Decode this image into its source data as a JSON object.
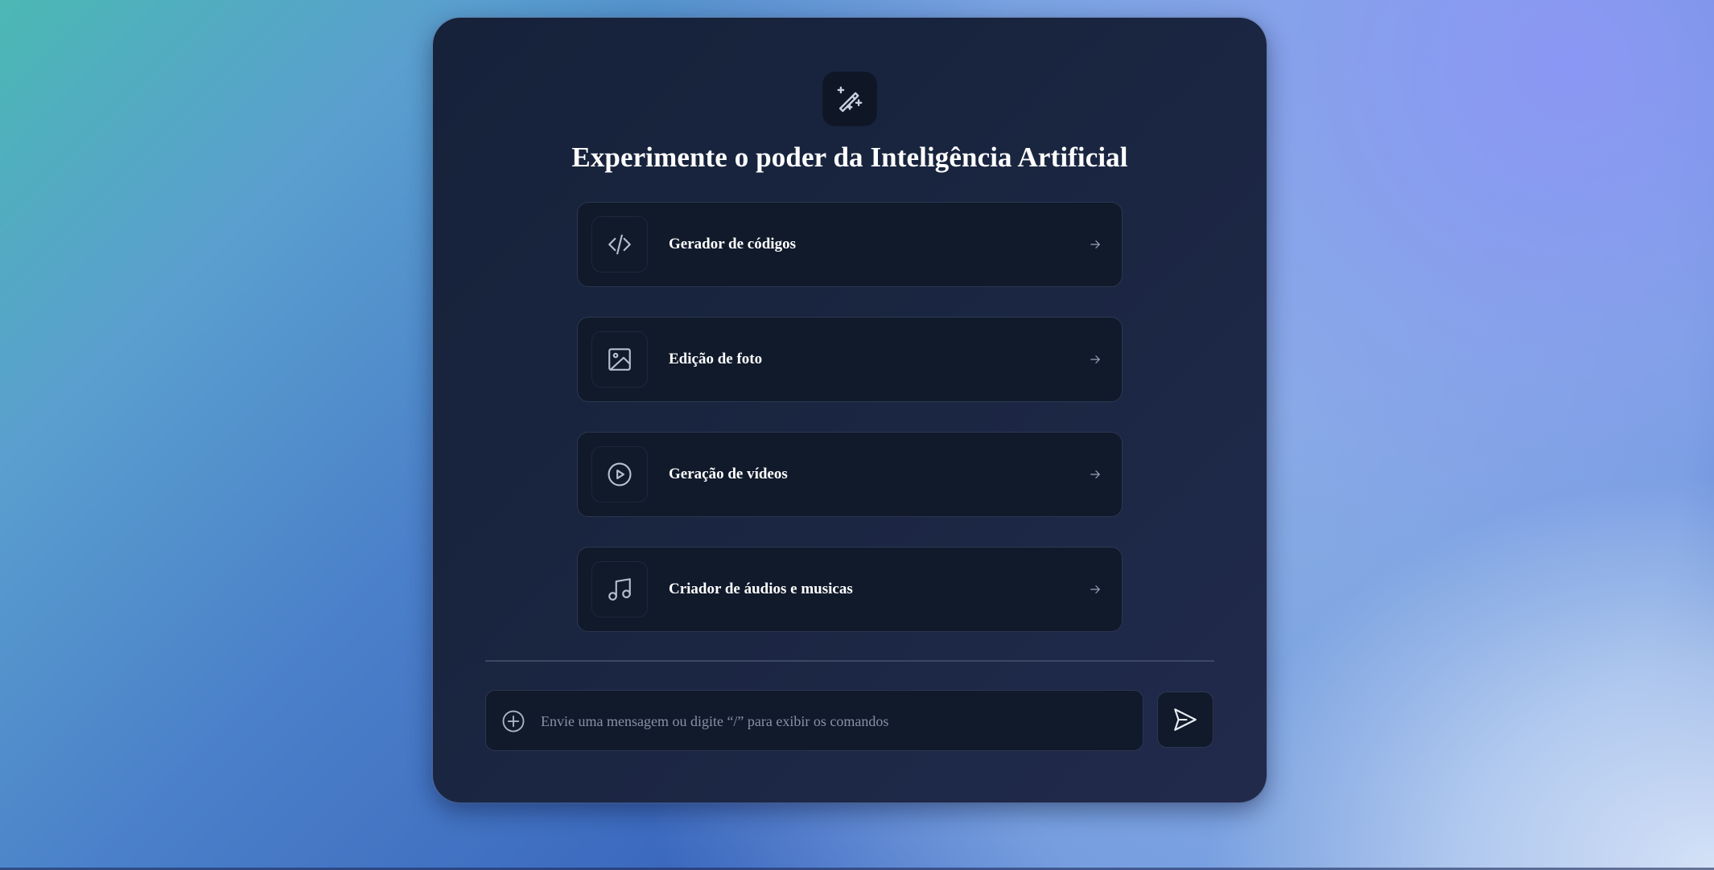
{
  "header": {
    "icon": "magic-wand-sparkles-icon",
    "title": "Experimente o poder da Inteligência Artificial"
  },
  "options": [
    {
      "label": "Gerador de códigos",
      "icon": "code-icon"
    },
    {
      "label": "Edição de foto",
      "icon": "image-icon"
    },
    {
      "label": "Geração de vídeos",
      "icon": "play-circle-icon"
    },
    {
      "label": "Criador de áudios e musicas",
      "icon": "music-note-icon"
    }
  ],
  "composer": {
    "placeholder": "Envie uma mensagem ou digite “/” para exibir os comandos",
    "value": "",
    "add_icon": "plus-circle-icon",
    "send_icon": "send-icon"
  },
  "colors": {
    "card_background": "#16223a",
    "tile_background": "#111a2b",
    "tile_border": "#2b3750",
    "text": "#ffffff",
    "icon_stroke": "#b7c0d0"
  }
}
